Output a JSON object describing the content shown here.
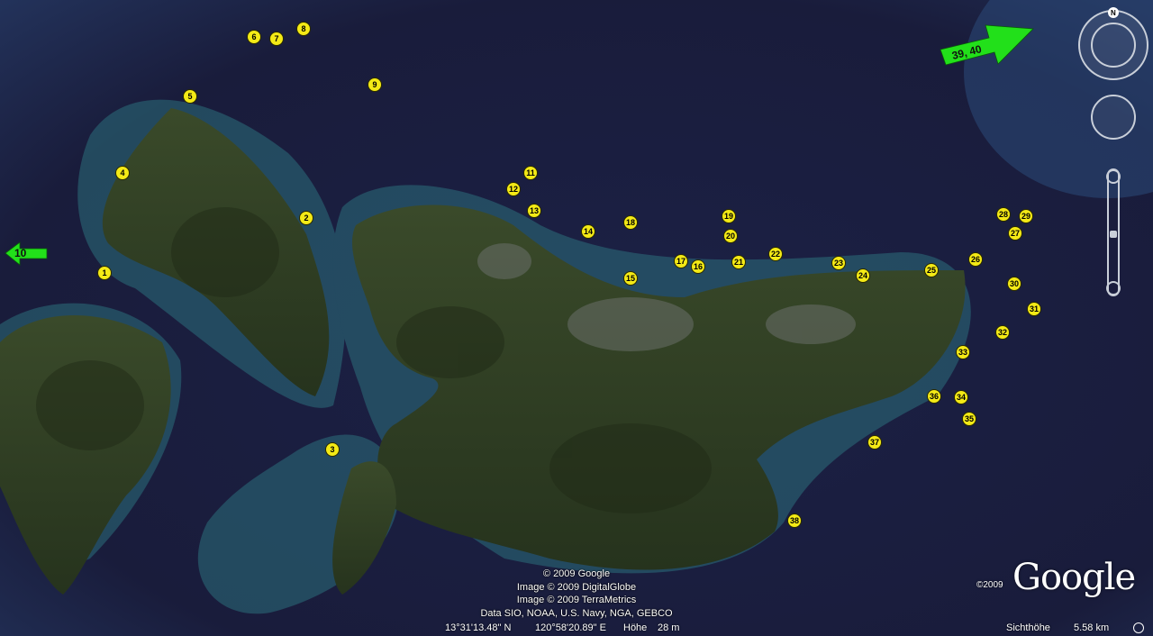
{
  "markers": [
    "1",
    "2",
    "3",
    "4",
    "5",
    "6",
    "7",
    "8",
    "9",
    "11",
    "12",
    "13",
    "14",
    "15",
    "16",
    "17",
    "18",
    "19",
    "20",
    "21",
    "22",
    "23",
    "24",
    "25",
    "26",
    "27",
    "28",
    "29",
    "30",
    "31",
    "32",
    "33",
    "34",
    "35",
    "36",
    "37",
    "38"
  ],
  "arrows": {
    "left_label": "10",
    "right_label": "39, 40"
  },
  "copyright": [
    "© 2009 Google",
    "Image © 2009 DigitalGlobe",
    "Image © 2009 TerraMetrics",
    "Data SIO, NOAA, U.S. Navy, NGA, GEBCO"
  ],
  "status": {
    "lat": "13°31'13.48\"  N",
    "lon": "120°58'20.89\" E",
    "elevation_label": "Höhe",
    "elevation": "28 m",
    "eye_alt_label": "Sichthöhe",
    "eye_alt": "5.58 km"
  },
  "logo": {
    "text": "Google",
    "year": "©2009"
  },
  "compass": {
    "north": "N"
  },
  "colors": {
    "marker": "#f4ea16",
    "arrow": "#22e01a",
    "sea": "#1a1d3a",
    "land": "#2c3a20"
  }
}
